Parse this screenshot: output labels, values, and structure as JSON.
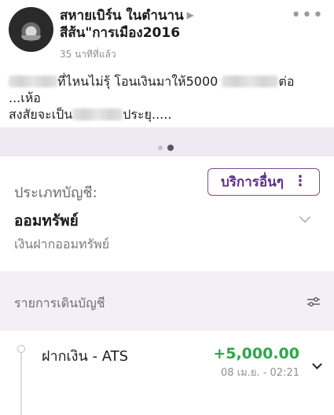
{
  "post": {
    "author_line1": "สหายเบิร์น ในตำนาน",
    "author_line2": "สีส้น\"การเมือง2016",
    "time": "35 นาทีที่แล้ว",
    "line1_text": "ที่ไหนไม่รุ้ โอนเงินมาให้5000",
    "line1_end": "ต่อ",
    "line2": "...เห้อ",
    "line3_start": "สงสัยจะเป็น",
    "line3_end": "ประยุ.....",
    "more_label": "•••"
  },
  "carousel": {
    "pages": 2,
    "active_page": 2
  },
  "account": {
    "type_label": "ประเภทบัญชี:",
    "type_value": "ออมทรัพย์",
    "type_sub": "เงินฝากออมทรัพย์",
    "services_button": "บริการอื่นๆ",
    "services_icon": "⋮"
  },
  "transactions": {
    "title": "รายการเดินบัญชี",
    "items": [
      {
        "name": "ฝากเงิน - ATS",
        "amount": "+5,000.00",
        "date": "08 เม.ย. - 02:21"
      }
    ]
  },
  "colors": {
    "accent": "#5c2f84",
    "positive": "#2ba84a",
    "strip_bg": "#efe9f3"
  }
}
